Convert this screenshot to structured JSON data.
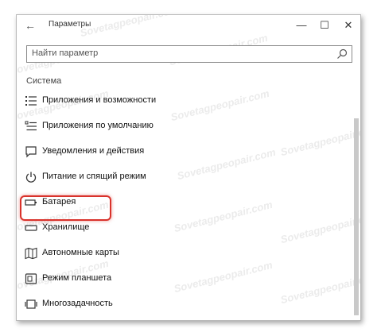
{
  "window": {
    "title": "Параметры",
    "back_label": "←",
    "minimize_label": "—",
    "maximize_label": "☐",
    "close_label": "✕"
  },
  "search": {
    "placeholder": "Найти параметр",
    "icon": "search-icon"
  },
  "section": {
    "title": "Система"
  },
  "items": [
    {
      "label": "Приложения и возможности",
      "icon": "apps-list-icon"
    },
    {
      "label": "Приложения по умолчанию",
      "icon": "default-apps-icon"
    },
    {
      "label": "Уведомления и действия",
      "icon": "notifications-icon"
    },
    {
      "label": "Питание и спящий режим",
      "icon": "power-icon"
    },
    {
      "label": "Батарея",
      "icon": "battery-icon"
    },
    {
      "label": "Хранилище",
      "icon": "storage-icon"
    },
    {
      "label": "Автономные карты",
      "icon": "offline-maps-icon"
    },
    {
      "label": "Режим планшета",
      "icon": "tablet-mode-icon"
    },
    {
      "label": "Многозадачность",
      "icon": "multitasking-icon"
    }
  ],
  "highlight_color": "#d9322b",
  "watermark": "Sovetagpeopair.com"
}
